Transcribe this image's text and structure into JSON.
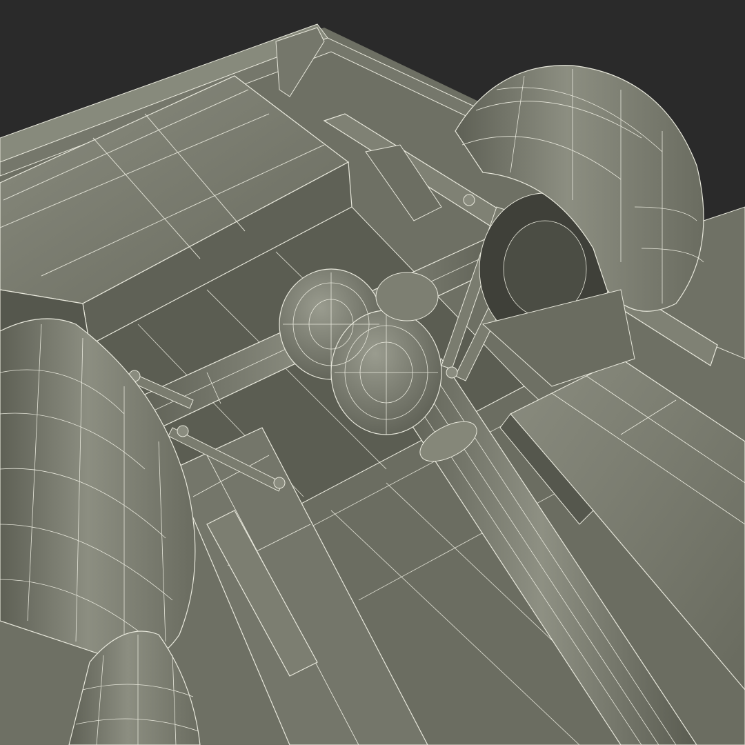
{
  "scene": {
    "subject": "truck-chassis-underside-wireframe",
    "colors": {
      "background": "#2a2a2a",
      "surface": "#7b7d70",
      "surface_dark": "#5d5f54",
      "surface_light": "#909284",
      "shadow": "#3f4039",
      "wire": "#e8e8dc"
    }
  }
}
